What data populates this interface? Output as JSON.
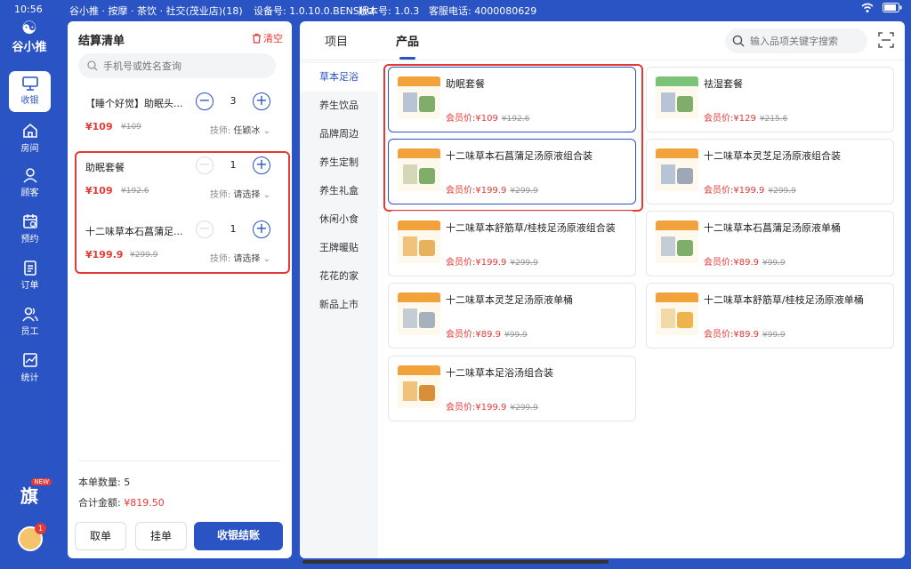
{
  "status": {
    "time": "10:56",
    "store": "谷小推 · 按摩 · 茶饮 · 社交(茂业店)(18)",
    "device": "设备号: 1.0.10.0.BENSHU",
    "version": "版本号: 1.0.3",
    "service": "客服电话: 4000080629"
  },
  "rail": {
    "logo_text": "谷小推",
    "items": [
      {
        "label": "收银",
        "icon": "cash-register-icon"
      },
      {
        "label": "房间",
        "icon": "home-icon"
      },
      {
        "label": "顾客",
        "icon": "user-icon"
      },
      {
        "label": "预约",
        "icon": "calendar-icon"
      },
      {
        "label": "订单",
        "icon": "order-icon"
      },
      {
        "label": "员工",
        "icon": "staff-icon"
      },
      {
        "label": "统计",
        "icon": "chart-icon"
      }
    ],
    "flag_label": "旗",
    "new_badge": "NEW",
    "avatar_badge": "1"
  },
  "cart": {
    "title": "结算清单",
    "clear_label": "清空",
    "search_placeholder": "手机号或姓名查询",
    "items": [
      {
        "name": "【睡个好觉】助眠头...",
        "price": "¥109",
        "orig": "¥109",
        "qty": "3",
        "tech_label": "技师:",
        "tech_value": "任颖冰"
      },
      {
        "name": "助眠套餐",
        "price": "¥109",
        "orig": "¥192.6",
        "qty": "1",
        "tech_label": "技师:",
        "tech_value": "请选择"
      },
      {
        "name": "十二味草本石菖蒲足...",
        "price": "¥199.9",
        "orig": "¥299.9",
        "qty": "1",
        "tech_label": "技师:",
        "tech_value": "请选择"
      }
    ],
    "count_label": "本单数量:",
    "count_value": "5",
    "total_label": "合计金额:",
    "total_value": "¥819.50",
    "btn_take": "取单",
    "btn_hold": "挂单",
    "btn_checkout": "收银结账"
  },
  "main": {
    "tabs": [
      "项目",
      "产品"
    ],
    "active_tab": "产品",
    "search_placeholder": "输入品项关键字搜索",
    "categories": [
      "草本足浴",
      "养生饮品",
      "品牌周边",
      "养生定制",
      "养生礼盒",
      "休闲小食",
      "王牌暖贴",
      "花花的家",
      "新品上市"
    ],
    "member_label": "会员价:",
    "products": [
      {
        "name": "助眠套餐",
        "price": "¥109",
        "orig": "¥192.6",
        "thumb": "助眠套餐"
      },
      {
        "name": "祛湿套餐",
        "price": "¥129",
        "orig": "¥215.6",
        "thumb": "祛湿套餐"
      },
      {
        "name": "十二味草本石菖蒲足汤原液组合装",
        "price": "¥199.9",
        "orig": "¥299.9",
        "thumb": "石菖蒲足汤"
      },
      {
        "name": "十二味草本灵芝足汤原液组合装",
        "price": "¥199.9",
        "orig": "¥299.9",
        "thumb": "灵芝足汤"
      },
      {
        "name": "十二味草本舒筋草/桂枝足汤原液组合装",
        "price": "¥199.9",
        "orig": "¥299.9",
        "thumb": "舒筋草足汤"
      },
      {
        "name": "十二味草本石菖蒲足汤原液单桶",
        "price": "¥89.9",
        "orig": "¥99.9",
        "thumb": "石菖蒲单桶"
      },
      {
        "name": "十二味草本灵芝足汤原液单桶",
        "price": "¥89.9",
        "orig": "¥99.9",
        "thumb": "灵芝单桶"
      },
      {
        "name": "十二味草本舒筋草/桂枝足汤原液单桶",
        "price": "¥89.9",
        "orig": "¥99.9",
        "thumb": "舒筋草单桶"
      },
      {
        "name": "十二味草本足浴汤组合装",
        "price": "¥199.9",
        "orig": "¥299.9",
        "thumb": "足浴汤组合"
      }
    ]
  },
  "colors": {
    "accent": "#2a53c4",
    "price": "#e53935",
    "highlight": "#e53935"
  }
}
